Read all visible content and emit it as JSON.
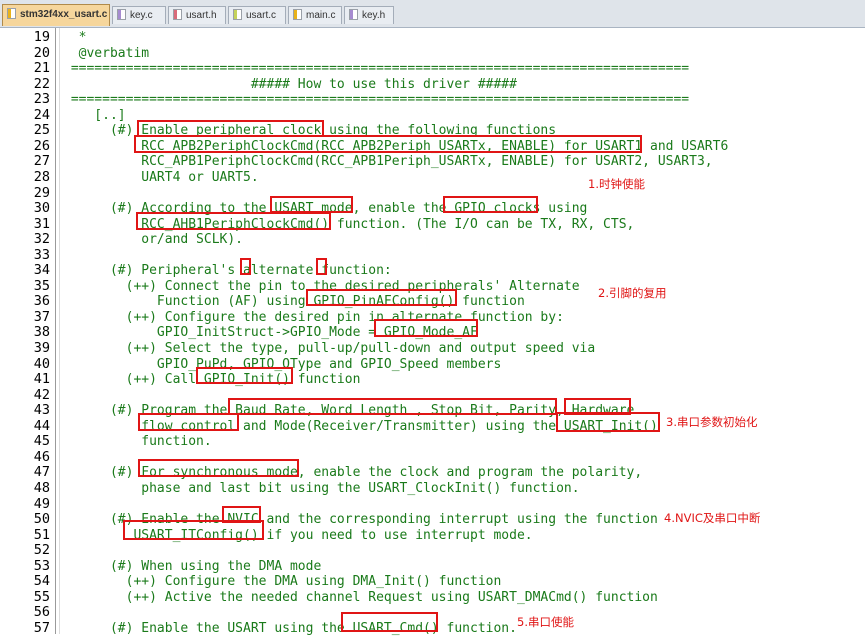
{
  "tabs": [
    {
      "label": "stm32f4xx_usart.c",
      "active": true,
      "type": "c"
    },
    {
      "label": "key.c",
      "active": false,
      "type": "k"
    },
    {
      "label": "usart.h",
      "active": false,
      "type": "u"
    },
    {
      "label": "usart.c",
      "active": false,
      "type": "h"
    },
    {
      "label": "main.c",
      "active": false,
      "type": "m"
    },
    {
      "label": "key.h",
      "active": false,
      "type": "k"
    }
  ],
  "lines": [
    {
      "n": "19",
      "t": "  *"
    },
    {
      "n": "20",
      "t": "  @verbatim"
    },
    {
      "n": "21",
      "t": " ==============================================================================="
    },
    {
      "n": "22",
      "t": "                        ##### How to use this driver #####"
    },
    {
      "n": "23",
      "t": " ==============================================================================="
    },
    {
      "n": "24",
      "t": "    [..]"
    },
    {
      "n": "25",
      "t": "      (#) Enable peripheral clock using the following functions"
    },
    {
      "n": "26",
      "t": "          RCC_APB2PeriphClockCmd(RCC_APB2Periph_USARTx, ENABLE) for USART1 and USART6"
    },
    {
      "n": "27",
      "t": "          RCC_APB1PeriphClockCmd(RCC_APB1Periph_USARTx, ENABLE) for USART2, USART3,"
    },
    {
      "n": "28",
      "t": "          UART4 or UART5."
    },
    {
      "n": "29",
      "t": ""
    },
    {
      "n": "30",
      "t": "      (#) According to the USART mode, enable the GPIO clocks using"
    },
    {
      "n": "31",
      "t": "          RCC_AHB1PeriphClockCmd() function. (The I/O can be TX, RX, CTS,"
    },
    {
      "n": "32",
      "t": "          or/and SCLK)."
    },
    {
      "n": "33",
      "t": ""
    },
    {
      "n": "34",
      "t": "      (#) Peripheral's alternate function:"
    },
    {
      "n": "35",
      "t": "        (++) Connect the pin to the desired peripherals' Alternate"
    },
    {
      "n": "36",
      "t": "            Function (AF) using GPIO_PinAFConfig() function"
    },
    {
      "n": "37",
      "t": "        (++) Configure the desired pin in alternate function by:"
    },
    {
      "n": "38",
      "t": "            GPIO_InitStruct->GPIO_Mode = GPIO_Mode_AF"
    },
    {
      "n": "39",
      "t": "        (++) Select the type, pull-up/pull-down and output speed via"
    },
    {
      "n": "40",
      "t": "            GPIO_PuPd, GPIO_OType and GPIO_Speed members"
    },
    {
      "n": "41",
      "t": "        (++) Call GPIO_Init() function"
    },
    {
      "n": "42",
      "t": ""
    },
    {
      "n": "43",
      "t": "      (#) Program the Baud Rate, Word Length , Stop Bit, Parity, Hardware"
    },
    {
      "n": "44",
      "t": "          flow control and Mode(Receiver/Transmitter) using the USART_Init()"
    },
    {
      "n": "45",
      "t": "          function."
    },
    {
      "n": "46",
      "t": ""
    },
    {
      "n": "47",
      "t": "      (#) For synchronous mode, enable the clock and program the polarity,"
    },
    {
      "n": "48",
      "t": "          phase and last bit using the USART_ClockInit() function."
    },
    {
      "n": "49",
      "t": ""
    },
    {
      "n": "50",
      "t": "      (#) Enable the NVIC and the corresponding interrupt using the function"
    },
    {
      "n": "51",
      "t": "         USART_ITConfig() if you need to use interrupt mode."
    },
    {
      "n": "52",
      "t": ""
    },
    {
      "n": "53",
      "t": "      (#) When using the DMA mode"
    },
    {
      "n": "54",
      "t": "        (++) Configure the DMA using DMA_Init() function"
    },
    {
      "n": "55",
      "t": "        (++) Active the needed channel Request using USART_DMACmd() function"
    },
    {
      "n": "56",
      "t": ""
    },
    {
      "n": "57",
      "t": "      (#) Enable the USART using the USART_Cmd() function."
    }
  ],
  "notes": {
    "clock": "1.时钟使能",
    "pins": "2.引脚的复用",
    "init": "3.串口参数初始化",
    "nvic": "4.NVIC及串口中断",
    "enable": "5.串口使能"
  },
  "colors": {
    "code_text": "#1a7a1a",
    "annotation": "#e01515",
    "active_tab": "#f6d69c"
  }
}
